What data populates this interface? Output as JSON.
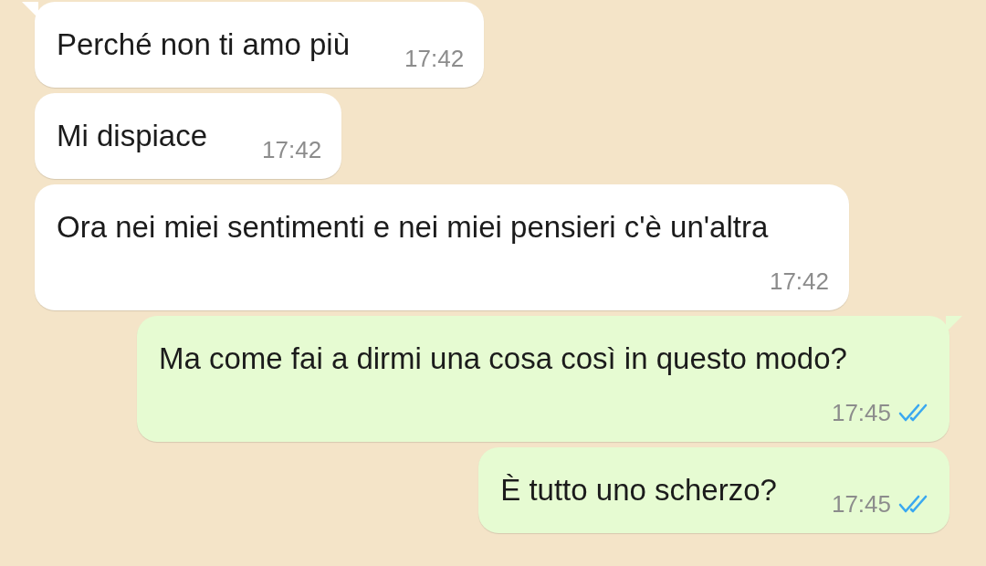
{
  "messages": [
    {
      "kind": "incoming",
      "text": "Perché non ti amo più",
      "time": "17:42",
      "tail": true
    },
    {
      "kind": "incoming",
      "text": "Mi dispiace",
      "time": "17:42",
      "tail": false
    },
    {
      "kind": "incoming",
      "text": "Ora nei miei sentimenti e nei miei pensieri c'è un'altra",
      "time": "17:42",
      "tail": false
    },
    {
      "kind": "outgoing",
      "text": "Ma come fai a dirmi una cosa così in questo modo?",
      "time": "17:45",
      "read": true,
      "tail": true
    },
    {
      "kind": "outgoing",
      "text": "È tutto uno scherzo?",
      "time": "17:45",
      "read": true,
      "tail": false
    }
  ]
}
